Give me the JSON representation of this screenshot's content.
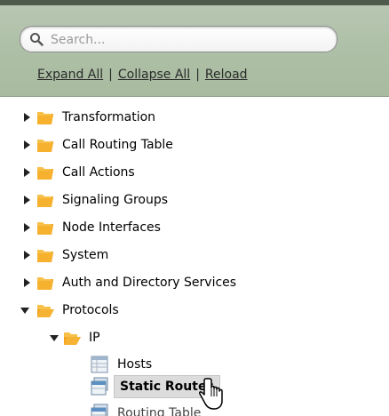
{
  "search": {
    "placeholder": "Search..."
  },
  "links": {
    "expand_all": "Expand All",
    "collapse_all": "Collapse All",
    "reload": "Reload",
    "separator": "|"
  },
  "tree": {
    "items": [
      {
        "label": "Transformation",
        "expanded": false
      },
      {
        "label": "Call Routing Table",
        "expanded": false
      },
      {
        "label": "Call Actions",
        "expanded": false
      },
      {
        "label": "Signaling Groups",
        "expanded": false
      },
      {
        "label": "Node Interfaces",
        "expanded": false
      },
      {
        "label": "System",
        "expanded": false
      },
      {
        "label": "Auth and Directory Services",
        "expanded": false
      },
      {
        "label": "Protocols",
        "expanded": true
      }
    ],
    "ip": {
      "label": "IP",
      "expanded": true
    },
    "ip_children": [
      {
        "label": "Hosts",
        "icon": "table-icon"
      },
      {
        "label": "Static Routes",
        "icon": "multi-table-icon",
        "selected": true
      },
      {
        "label": "Routing Table",
        "icon": "multi-table-icon",
        "partially_visible": true
      }
    ]
  },
  "colors": {
    "header": "#adbfa6",
    "folder": "#f5a623",
    "selection": "#dcdcdc"
  }
}
